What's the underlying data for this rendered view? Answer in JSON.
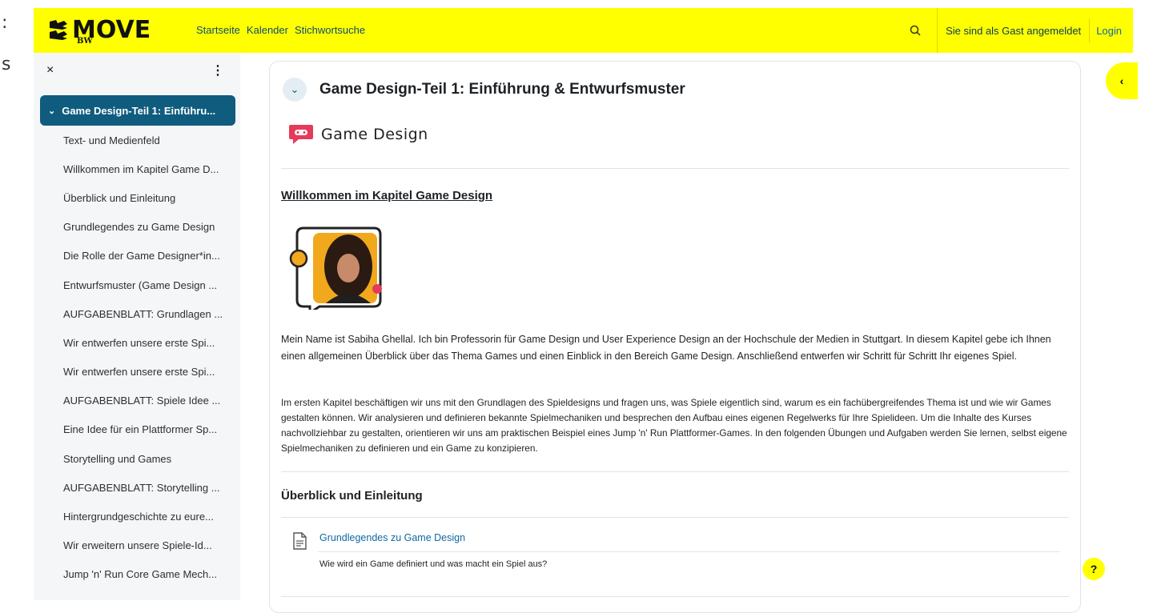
{
  "outer_fragments": [
    ":",
    "s"
  ],
  "brand": {
    "logo_text": "MOVE",
    "logo_sub": "BW"
  },
  "nav": {
    "items": [
      "Startseite",
      "Kalender",
      "Stichwortsuche"
    ]
  },
  "header": {
    "guest_text": "Sie sind als Gast angemeldet",
    "login_label": "Login"
  },
  "drawer": {
    "close_label": "×",
    "more_label": "⋮",
    "active_section": "Game Design-Teil 1: Einführu...",
    "items": [
      "Text- und Medienfeld",
      "Willkommen im Kapitel Game D...",
      "Überblick und Einleitung",
      "Grundlegendes zu Game Design",
      "Die Rolle der Game Designer*in...",
      "Entwurfsmuster (Game Design ...",
      "AUFGABENBLATT: Grundlagen ...",
      "Wir entwerfen unsere erste Spi...",
      "Wir entwerfen unsere erste Spi...",
      "AUFGABENBLATT: Spiele Idee ...",
      "Eine Idee für ein Plattformer Sp...",
      "Storytelling und Games",
      "AUFGABENBLATT: Storytelling ...",
      "Hintergrundgeschichte zu eure...",
      "Wir erweitern unsere Spiele-Id...",
      "Jump 'n' Run Core Game Mech..."
    ]
  },
  "content": {
    "section_title": "Game Design-Teil 1: Einführung & Entwurfsmuster",
    "course_logo_text": "Game Design",
    "welcome_heading": "Willkommen im Kapitel Game Design",
    "para1": "Mein Name ist Sabiha Ghellal. Ich bin Professorin für Game Design und User Experience Design an der Hochschule der Medien in Stuttgart. In diesem Kapitel gebe ich Ihnen einen allgemeinen Überblick über das Thema Games und einen Einblick in den Bereich Game Design. Anschließend entwerfen wir Schritt für Schritt Ihr eigenes Spiel.",
    "para2": "Im ersten Kapitel beschäftigen wir uns mit den Grundlagen des Spieldesigns und fragen uns, was Spiele eigentlich sind, warum es ein fachübergreifendes Thema ist und wie wir Games gestalten können. Wir analysieren und definieren bekannte Spielmechaniken und besprechen den Aufbau eines eigenen Regelwerks für Ihre Spielideen. Um die Inhalte des Kurses nachvollziehbar zu gestalten, orientieren wir uns am praktischen Beispiel eines Jump 'n' Run Plattformer-Games. In den folgenden Übungen und Aufgaben werden Sie lernen, selbst eigene Spielmechaniken zu definieren und ein Game zu konzipieren.",
    "subheading": "Überblick und Einleitung",
    "activity": {
      "link": "Grundlegendes zu Game Design",
      "description": "Wie wird ein Game definiert und was macht ein Spiel aus?"
    }
  },
  "help_label": "?",
  "colors": {
    "brand_yellow": "#ffff00",
    "accent": "#0f5c7e",
    "link": "#0f6aa0"
  }
}
